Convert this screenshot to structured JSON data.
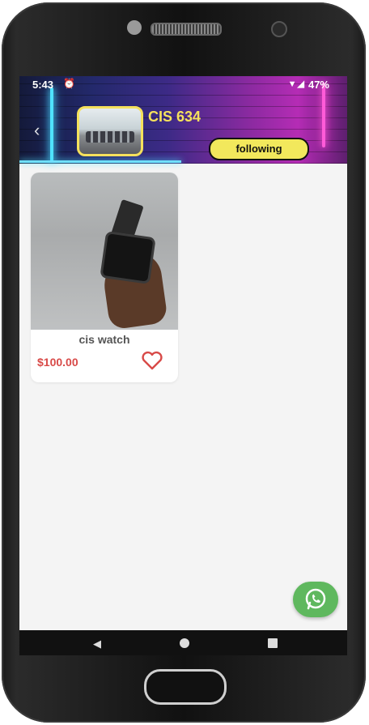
{
  "status_bar": {
    "time": "5:43",
    "alarm_icon": "⏰",
    "signal_icons": "▼◢",
    "battery_percent": "47%"
  },
  "header": {
    "back_icon": "‹",
    "title": "CIS 634",
    "follow_label": "following"
  },
  "products": [
    {
      "name": "cis watch",
      "price": "$100.00",
      "favorite_icon": "heart-icon"
    }
  ],
  "floating_action": {
    "icon": "whatsapp-icon",
    "color": "#5fb85e"
  },
  "navigation": {
    "back_icon": "◀"
  },
  "colors": {
    "accent_yellow": "#f5e15c",
    "price_red": "#d84a48",
    "whatsapp_green": "#5fb85e"
  }
}
